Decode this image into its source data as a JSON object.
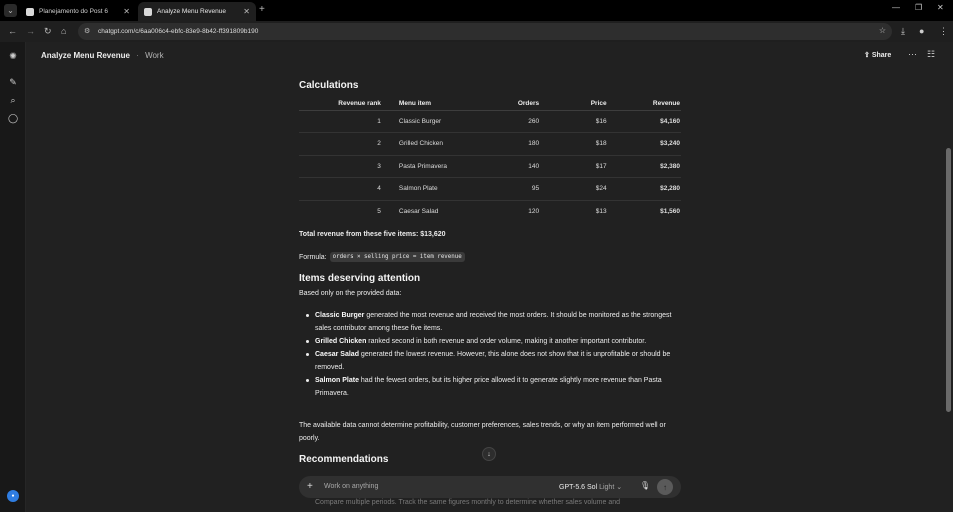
{
  "browser": {
    "tabs": [
      {
        "title": "Planejamento do Post 6",
        "active": false
      },
      {
        "title": "Analyze Menu Revenue",
        "active": true
      }
    ],
    "url": "chatgpt.com/c/6aa006c4-ebfc-83e9-8b42-ff391809b190"
  },
  "header": {
    "title": "Analyze Menu Revenue",
    "separator": "·",
    "subtitle": "Work",
    "share_label": "Share"
  },
  "content": {
    "calculations_heading": "Calculations",
    "table": {
      "columns": [
        "Revenue rank",
        "Menu item",
        "Orders",
        "Price",
        "Revenue"
      ],
      "rows": [
        [
          "1",
          "Classic Burger",
          "260",
          "$16",
          "$4,160"
        ],
        [
          "2",
          "Grilled Chicken",
          "180",
          "$18",
          "$3,240"
        ],
        [
          "3",
          "Pasta Primavera",
          "140",
          "$17",
          "$2,380"
        ],
        [
          "4",
          "Salmon Plate",
          "95",
          "$24",
          "$2,280"
        ],
        [
          "5",
          "Caesar Salad",
          "120",
          "$13",
          "$1,560"
        ]
      ]
    },
    "total": "Total revenue from these five items: $13,620",
    "formula_label": "Formula:",
    "formula_code": "orders × selling price = item revenue",
    "attention_heading": "Items deserving attention",
    "based_on": "Based only on the provided data:",
    "bullets": [
      {
        "bold": "Classic Burger",
        "text": " generated the most revenue and received the most orders. It should be monitored as the strongest sales contributor among these five items."
      },
      {
        "bold": "Grilled Chicken",
        "text": " ranked second in both revenue and order volume, making it another important contributor."
      },
      {
        "bold": "Caesar Salad",
        "text": " generated the lowest revenue. However, this alone does not show that it is unprofitable or should be removed."
      },
      {
        "bold": "Salmon Plate",
        "text": " had the fewest orders, but its higher price allowed it to generate slightly more revenue than Pasta Primavera."
      }
    ],
    "disclaimer": "The available data cannot determine profitability, customer preferences, sales trends, or why an item performed well or poorly.",
    "recommendations_heading": "Recommendations",
    "faded_line": "Compare multiple periods. Track the same figures monthly to determine whether sales volume and"
  },
  "composer": {
    "placeholder": "Work on anything",
    "model": "GPT-5.6 Sol",
    "model_mode": "Light"
  }
}
